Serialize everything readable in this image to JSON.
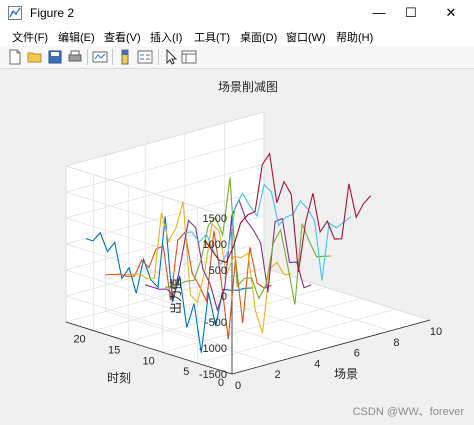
{
  "window": {
    "title": "Figure 2",
    "controls": {
      "minimize": "—",
      "maximize": "☐",
      "close": "✕"
    },
    "icon": "matlab-figure-icon"
  },
  "menu": {
    "items": [
      "文件(F)",
      "编辑(E)",
      "查看(V)",
      "插入(I)",
      "工具(T)",
      "桌面(D)",
      "窗口(W)",
      "帮助(H)"
    ]
  },
  "toolbar": {
    "buttons": [
      "new-figure-icon",
      "open-file-icon",
      "save-icon",
      "print-icon",
      "link-plot-icon",
      "insert-colorbar-icon",
      "insert-legend-icon",
      "edit-plot-arrow-icon",
      "property-inspector-icon"
    ]
  },
  "chart_data": {
    "type": "line",
    "title": "场景削减图",
    "xlabel": "场景",
    "ylabel": "时刻",
    "zlabel": "出力值",
    "xlim": [
      0,
      10
    ],
    "ylim": [
      0,
      24
    ],
    "zlim": [
      -1500,
      1500
    ],
    "xticks": [
      "0",
      "2",
      "4",
      "6",
      "8",
      "10"
    ],
    "yticks": [
      "0",
      "5",
      "10",
      "15",
      "20"
    ],
    "zticks": [
      "-1500",
      "-1000",
      "-500",
      "0",
      "500",
      "1000",
      "1500"
    ],
    "grid": true,
    "view": "3d",
    "colors": [
      "#0072BD",
      "#D95319",
      "#EDB120",
      "#7E2F8E",
      "#77AC30",
      "#4DBEEE",
      "#A2142F"
    ],
    "series": [
      {
        "x": 1,
        "values": [
          50,
          0,
          -80,
          -120,
          -150,
          -900,
          -300,
          -1550,
          -600,
          -1100,
          -150,
          -700,
          900,
          -500,
          -400,
          -50,
          -750,
          -300,
          -550,
          100,
          -120,
          200,
          0,
          0
        ]
      },
      {
        "x": 2,
        "values": [
          0,
          -100,
          -50,
          600,
          -900,
          300,
          -1300,
          -200,
          700,
          -700,
          -450,
          -250,
          500,
          300,
          -900,
          100,
          0,
          -400,
          -300,
          -650,
          -700,
          -700,
          -750,
          -800
        ]
      },
      {
        "x": 3,
        "values": [
          120,
          50,
          250,
          80,
          -1200,
          -800,
          250,
          120,
          100,
          -300,
          500,
          600,
          -350,
          -1000,
          -900,
          850,
          300,
          0,
          500,
          -800,
          -850,
          -800,
          -850,
          -900
        ]
      },
      {
        "x": 4,
        "values": [
          -200,
          -300,
          150,
          100,
          900,
          800,
          -600,
          300,
          500,
          650,
          1000,
          650,
          -800,
          -1250,
          -800,
          -550,
          200,
          300,
          -500,
          -1250,
          -1150,
          -1200,
          -1200,
          -1200
        ]
      },
      {
        "x": 5,
        "values": [
          250,
          200,
          150,
          400,
          700,
          -900,
          -200,
          450,
          150,
          -700,
          -1000,
          -650,
          -700,
          -900,
          1150,
          0,
          300,
          100,
          -600,
          -1050,
          -1100,
          -1200,
          -1300,
          -1350
        ]
      },
      {
        "x": 6,
        "values": [
          900,
          750,
          600,
          650,
          -500,
          600,
          800,
          900,
          600,
          500,
          300,
          900,
          1000,
          350,
          500,
          700,
          400,
          -500,
          -800,
          -600,
          -300,
          -500,
          -350,
          -400
        ]
      },
      {
        "x": 7,
        "values": [
          1200,
          1000,
          700,
          1300,
          200,
          150,
          450,
          200,
          900,
          300,
          -700,
          750,
          950,
          500,
          1400,
          1150,
          200,
          100,
          -100,
          -600,
          -950,
          -950,
          -800,
          -650
        ]
      }
    ]
  },
  "watermark": "CSDN @WW、forever"
}
